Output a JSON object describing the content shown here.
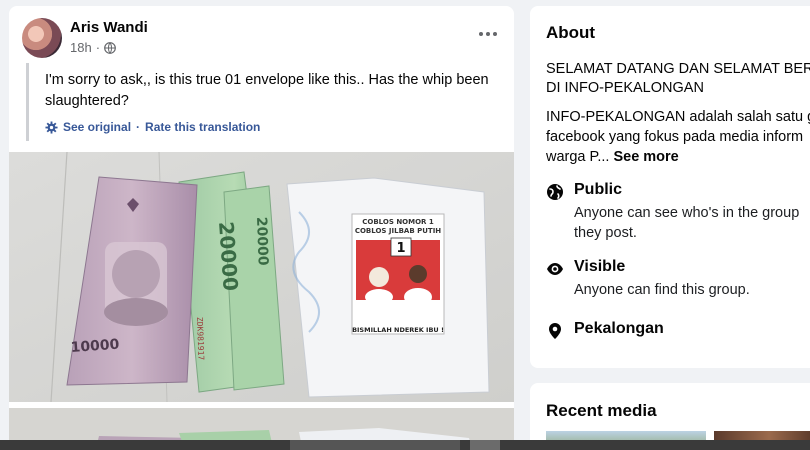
{
  "post": {
    "author": "Aris Wandi",
    "time": "18h",
    "audience_icon": "globe-icon",
    "text": "I'm sorry to ask,, is this true 01 envelope like this.. Has the whip been slaughtered?",
    "see_original": "See original",
    "separator": "·",
    "rate_translation": "Rate this translation",
    "photo_alt_icon": "photo",
    "money_labels": {
      "note1_value": "10000",
      "note2_value": "20000",
      "note3_value": "20000",
      "serial": "ZDK981917",
      "envelope_header1": "COBLOS NOMOR 1",
      "envelope_header2": "COBLOS JILBAB PUTIH",
      "envelope_number": "1",
      "envelope_footer": "BISMILLAH NDEREK IBU !"
    }
  },
  "about": {
    "title": "About",
    "desc_line1": "SELAMAT DATANG DAN SELAMAT BERG",
    "desc_line2": "DI INFO-PEKALONGAN",
    "desc_line3": "INFO-PEKALONGAN adalah salah satu g",
    "desc_line4": "facebook yang fokus pada media inform",
    "desc_line5": "warga P...",
    "see_more": "See more",
    "public_title": "Public",
    "public_sub1": "Anyone can see who's in the group",
    "public_sub2": "they post.",
    "visible_title": "Visible",
    "visible_sub": "Anyone can find this group.",
    "location_title": "Pekalongan"
  },
  "recent": {
    "title": "Recent media"
  },
  "colors": {
    "link": "#385898",
    "secondary_text": "#65676b",
    "background": "#f0f2f5"
  }
}
